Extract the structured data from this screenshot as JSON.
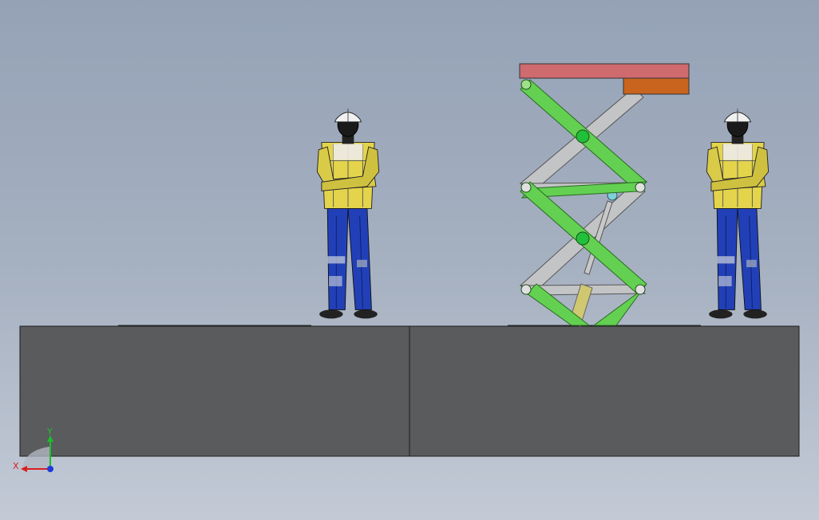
{
  "viewport": {
    "background_top": "#95a2b6",
    "background_bottom": "#c3cad6"
  },
  "triad": {
    "x_label": "X",
    "y_label": "Y",
    "x_color": "#d81e1e",
    "y_color": "#1bbf2c",
    "z_color": "#1e3adc"
  },
  "scene": {
    "base_color": "#5a5b5c",
    "platform_color": "#cf6a6e",
    "block_color": "#c8641e",
    "link_green": "#63d052",
    "link_gray": "#c3c4c6",
    "pin_green": "#20c03a",
    "cylinder_color": "#cfc870",
    "shirt_color": "#e3d44c",
    "pants_color": "#2140b8"
  }
}
